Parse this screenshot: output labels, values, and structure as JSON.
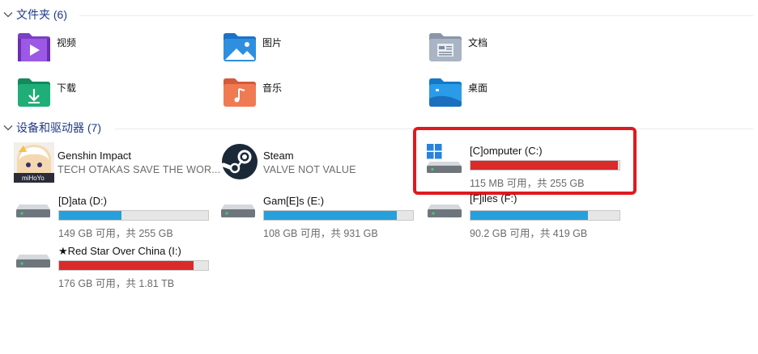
{
  "folders_section": {
    "title": "文件夹 (6)"
  },
  "folders": [
    {
      "label": "视频",
      "icon": "videos-folder-icon"
    },
    {
      "label": "图片",
      "icon": "pictures-folder-icon"
    },
    {
      "label": "文档",
      "icon": "documents-folder-icon"
    },
    {
      "label": "下载",
      "icon": "downloads-folder-icon"
    },
    {
      "label": "音乐",
      "icon": "music-folder-icon"
    },
    {
      "label": "桌面",
      "icon": "desktop-folder-icon"
    }
  ],
  "devices_section": {
    "title": "设备和驱动器 (7)"
  },
  "apps": [
    {
      "name": "Genshin Impact",
      "subtitle": "TECH OTAKAS SAVE THE WOR...",
      "icon": "genshin-impact-icon"
    },
    {
      "name": "Steam",
      "subtitle": "VALVE NOT VALUE",
      "icon": "steam-icon"
    }
  ],
  "drives": [
    {
      "name": "[C]omputer (C:)",
      "free_text": "115 MB 可用，共 255 GB",
      "used_fraction": 0.99,
      "bar_color": "#da2a2a",
      "icon": "windows-drive-icon",
      "highlighted": true
    },
    {
      "name": "[D]ata (D:)",
      "free_text": "149 GB 可用，共 255 GB",
      "used_fraction": 0.42,
      "bar_color": "#26a0da",
      "icon": "hard-drive-icon"
    },
    {
      "name": "Gam[E]s (E:)",
      "free_text": "108 GB 可用，共 931 GB",
      "used_fraction": 0.89,
      "bar_color": "#26a0da",
      "icon": "hard-drive-icon"
    },
    {
      "name": "[F]iles (F:)",
      "free_text": "90.2 GB 可用，共 419 GB",
      "used_fraction": 0.79,
      "bar_color": "#26a0da",
      "icon": "hard-drive-icon"
    },
    {
      "name": "★Red Star Over China (I:)",
      "free_text": "176 GB 可用，共 1.81 TB",
      "used_fraction": 0.9,
      "bar_color": "#da2a2a",
      "icon": "hard-drive-icon"
    }
  ]
}
